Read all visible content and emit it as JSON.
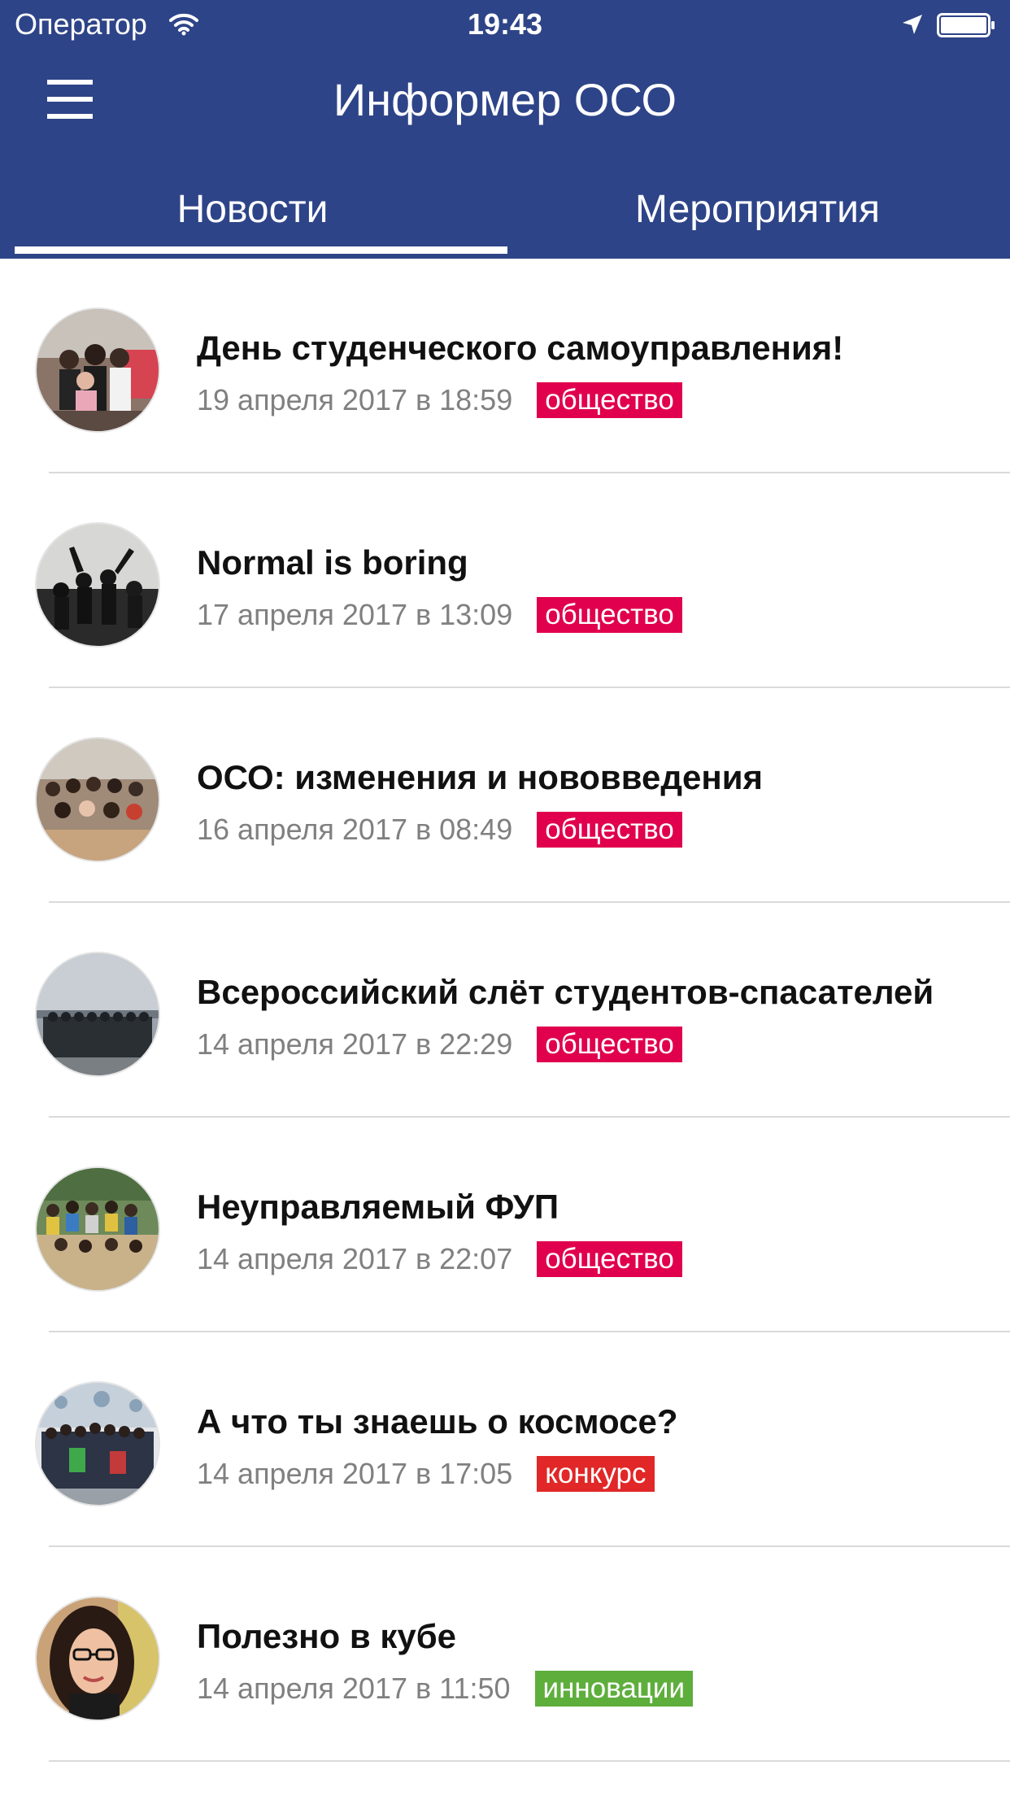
{
  "status_bar": {
    "carrier": "Оператор",
    "time": "19:43"
  },
  "header": {
    "title": "Информер ОСО",
    "menu_icon": "hamburger-menu-icon"
  },
  "tabs": [
    {
      "label": "Новости",
      "active": true
    },
    {
      "label": "Мероприятия",
      "active": false
    }
  ],
  "colors": {
    "header_bg": "#2e4488",
    "tag_society": "#e0004d",
    "tag_contest": "#e12727",
    "tag_innovation": "#5eae3c"
  },
  "news": [
    {
      "title": "День студенческого самоуправления!",
      "date": "19 апреля 2017 в 18:59",
      "tag": "общество",
      "tag_color": "#e0004d"
    },
    {
      "title": "Normal is boring",
      "date": "17 апреля 2017 в 13:09",
      "tag": "общество",
      "tag_color": "#e0004d"
    },
    {
      "title": "ОСО: изменения и нововведения",
      "date": "16 апреля 2017 в 08:49",
      "tag": "общество",
      "tag_color": "#e0004d"
    },
    {
      "title": "Всероссийский слёт студентов-спасателей",
      "date": "14 апреля 2017 в 22:29",
      "tag": "общество",
      "tag_color": "#e0004d"
    },
    {
      "title": "Неуправляемый ФУП",
      "date": "14 апреля 2017 в 22:07",
      "tag": "общество",
      "tag_color": "#e0004d"
    },
    {
      "title": "А что ты знаешь о космосе?",
      "date": "14 апреля 2017 в 17:05",
      "tag": "конкурс",
      "tag_color": "#e12727"
    },
    {
      "title": "Полезно в кубе",
      "date": "14 апреля 2017 в 11:50",
      "tag": "инновации",
      "tag_color": "#5eae3c"
    }
  ]
}
